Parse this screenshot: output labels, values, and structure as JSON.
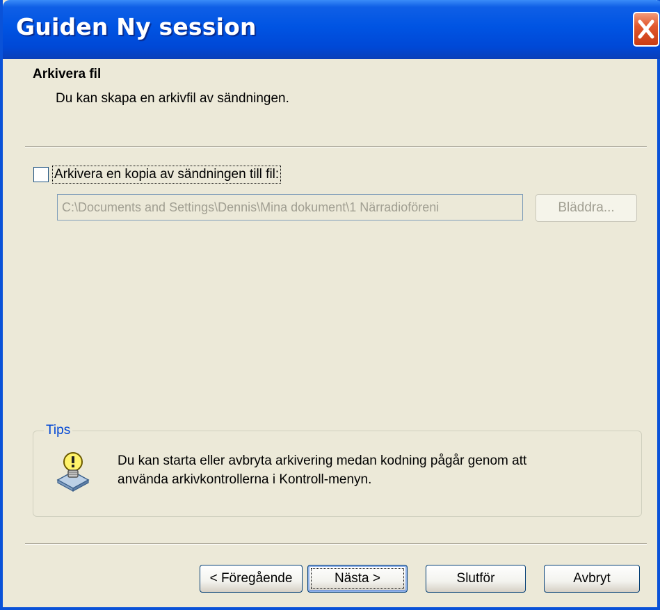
{
  "window": {
    "title": "Guiden Ny session"
  },
  "header": {
    "heading": "Arkivera fil",
    "subheading": "Du kan skapa en arkivfil av sändningen."
  },
  "archive": {
    "checkbox_label": "Arkivera en kopia av sändningen till fil:",
    "checked": false,
    "path_value": "C:\\Documents and Settings\\Dennis\\Mina dokument\\1 Närradioföreni",
    "browse_label": "Bläddra..."
  },
  "tips": {
    "legend": "Tips",
    "line1": "Du kan starta eller avbryta arkivering medan kodning pågår genom att",
    "line2": "använda arkivkontrollerna i Kontroll-menyn."
  },
  "buttons": {
    "back": "< Föregående",
    "next": "Nästa >",
    "finish": "Slutför",
    "cancel": "Avbryt"
  },
  "icons": {
    "close": "close-icon",
    "tip": "lightbulb-icon"
  },
  "colors": {
    "titlebar": "#0054e3",
    "dialog_bg": "#ece9d8",
    "tips_legend": "#0046d5",
    "close_button": "#e2582e"
  }
}
